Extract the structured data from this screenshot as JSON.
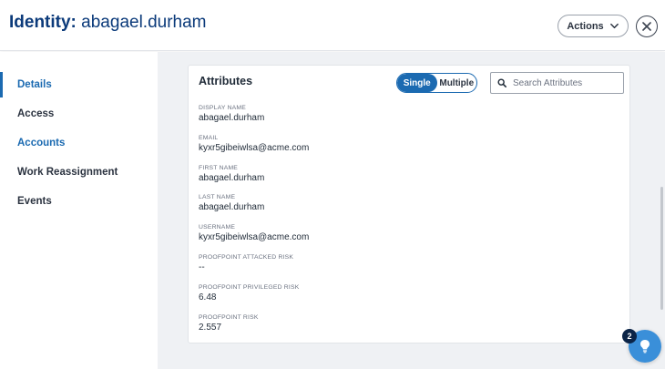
{
  "header": {
    "title_label": "Identity:",
    "title_value": "abagael.durham",
    "actions_label": "Actions"
  },
  "sidebar": {
    "items": [
      {
        "label": "Details"
      },
      {
        "label": "Access"
      },
      {
        "label": "Accounts"
      },
      {
        "label": "Work Reassignment"
      },
      {
        "label": "Events"
      }
    ]
  },
  "attributes": {
    "title": "Attributes",
    "toggle": {
      "single": "Single",
      "multiple": "Multiple",
      "selected": "Single"
    },
    "search_placeholder": "Search Attributes",
    "items": [
      {
        "label": "DISPLAY NAME",
        "value": "abagael.durham"
      },
      {
        "label": "EMAIL",
        "value": "kyxr5gibeiwlsa@acme.com"
      },
      {
        "label": "FIRST NAME",
        "value": "abagael.durham"
      },
      {
        "label": "LAST NAME",
        "value": "abagael.durham"
      },
      {
        "label": "USERNAME",
        "value": "kyxr5gibeiwlsa@acme.com"
      },
      {
        "label": "PROOFPOINT ATTACKED RISK",
        "value": "--"
      },
      {
        "label": "PROOFPOINT PRIVILEGED RISK",
        "value": "6.48"
      },
      {
        "label": "PROOFPOINT RISK",
        "value": "2.557"
      }
    ]
  },
  "help": {
    "badge_count": "2",
    "icon": "lightbulb-icon"
  },
  "colors": {
    "brand_navy": "#0b3a7a",
    "accent_blue": "#1b6ab1",
    "fab_blue": "#3a8fd9"
  }
}
